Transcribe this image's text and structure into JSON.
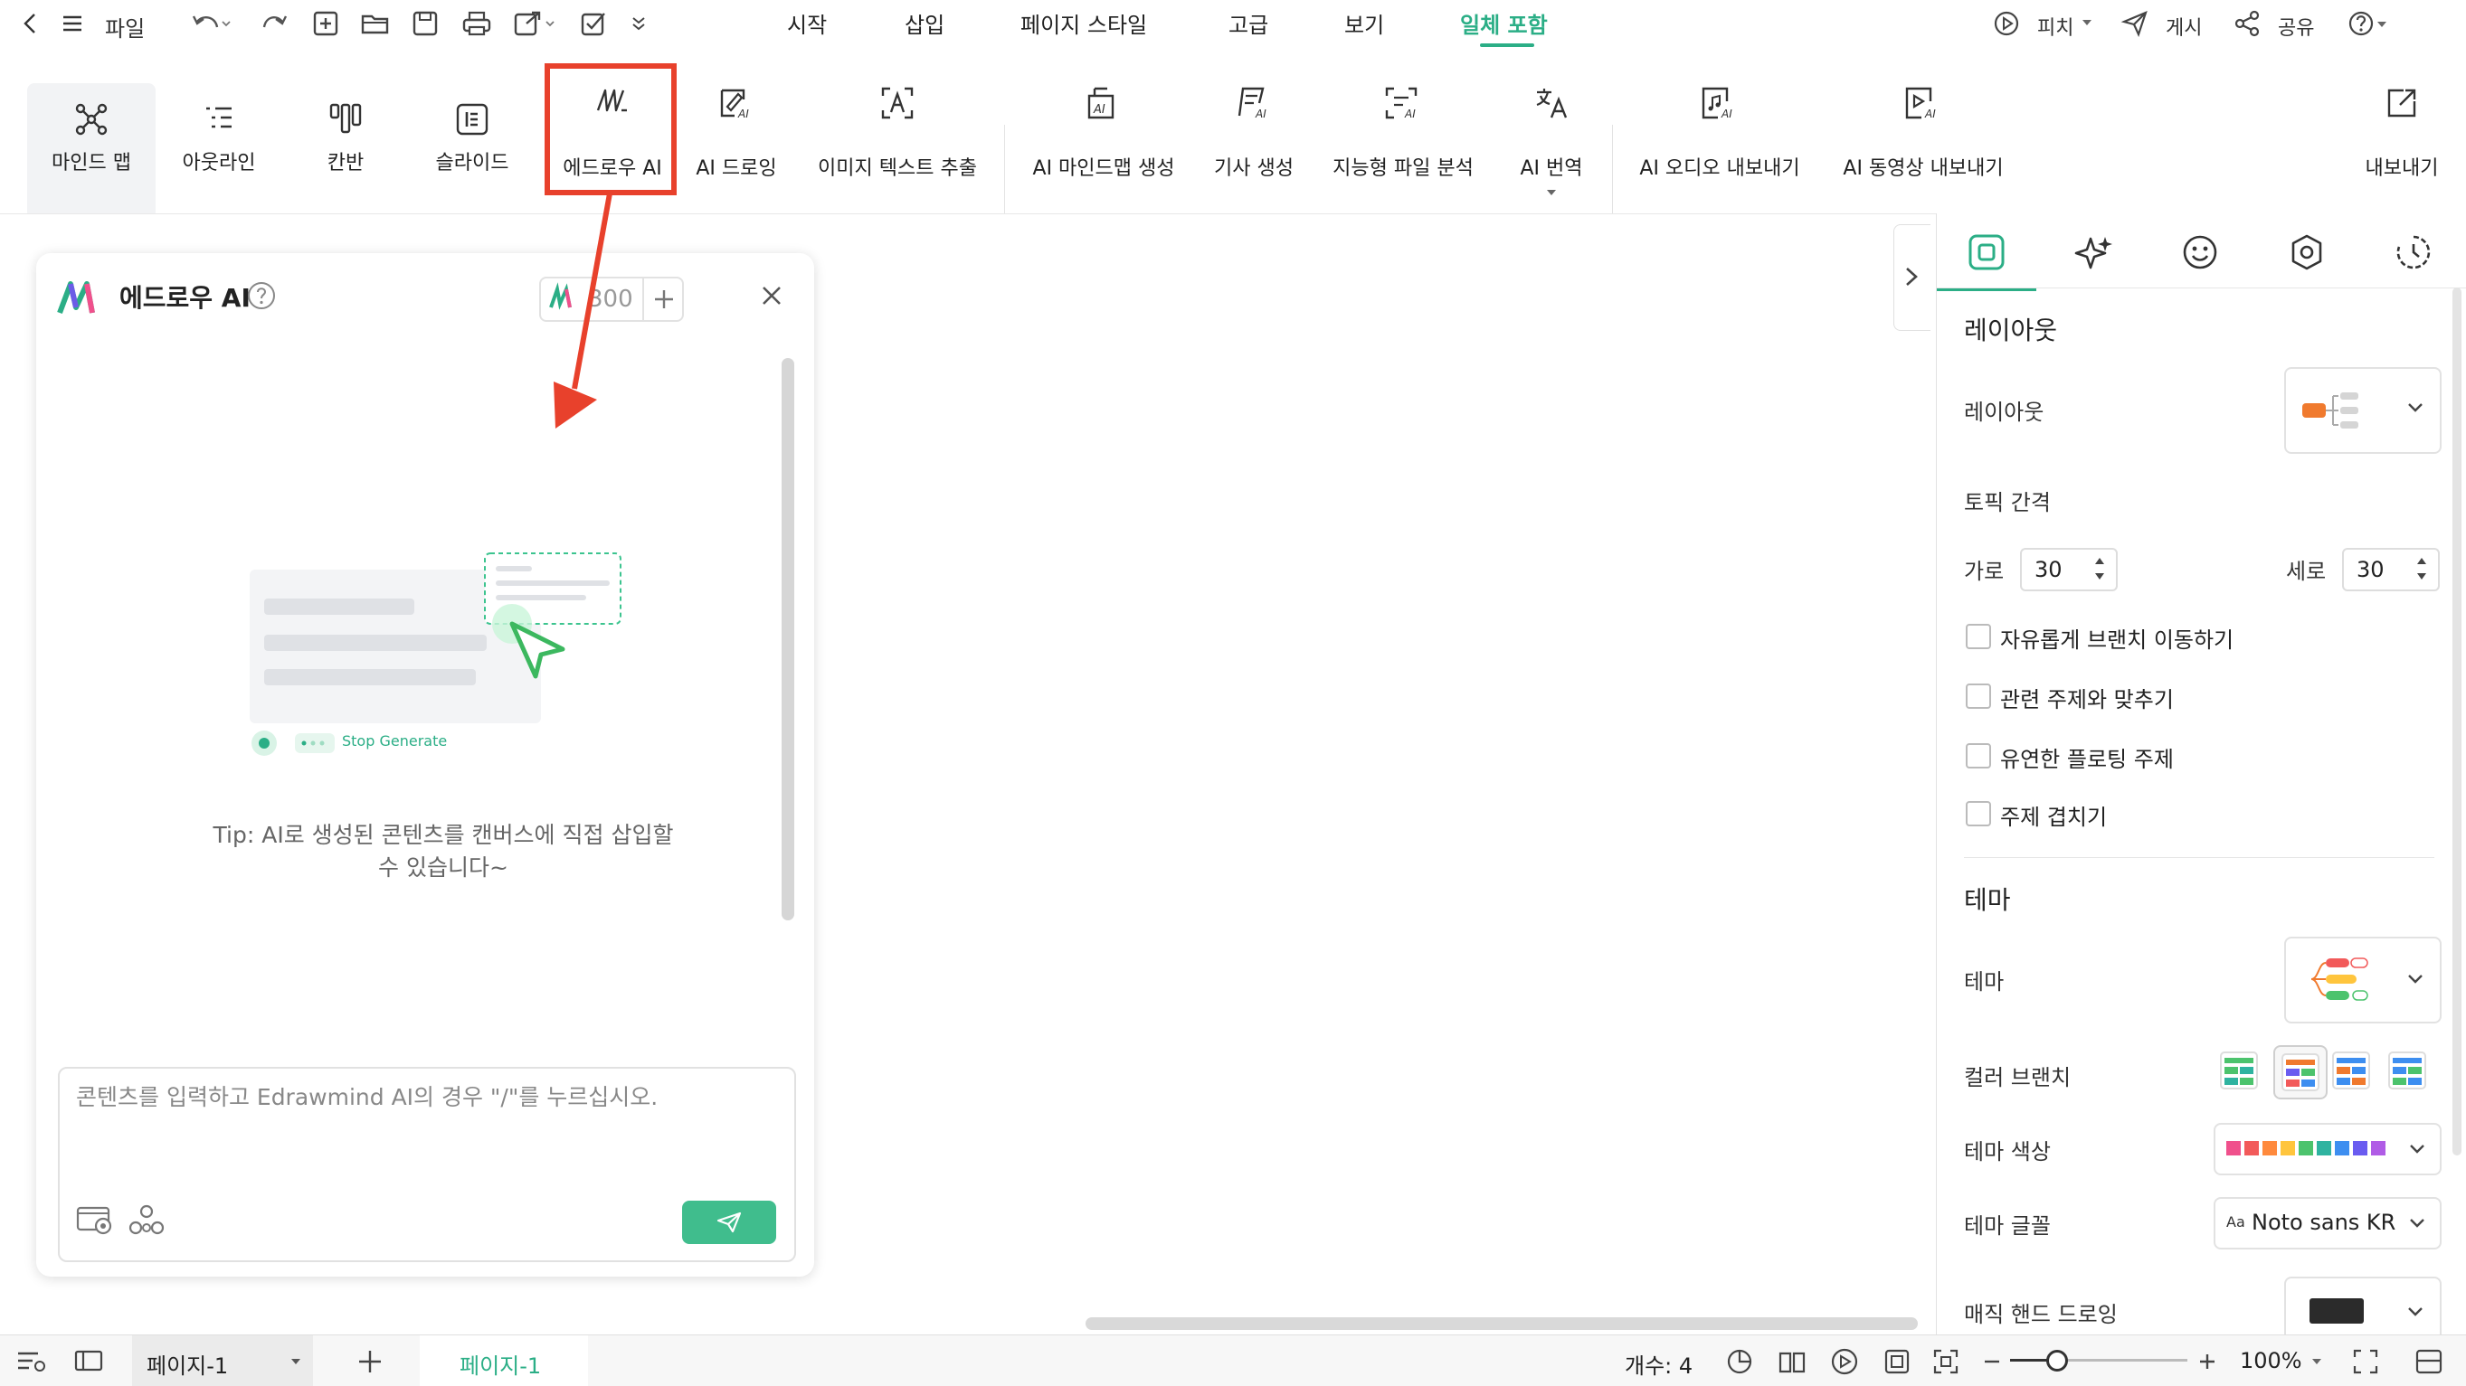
{
  "menubar": {
    "file_label": "파일",
    "tabs": [
      {
        "label": "시작"
      },
      {
        "label": "삽입"
      },
      {
        "label": "페이지 스타일"
      },
      {
        "label": "고급"
      },
      {
        "label": "보기"
      },
      {
        "label": "일체 포함",
        "active": true
      }
    ],
    "pitch_label": "피치",
    "publish_label": "게시",
    "share_label": "공유"
  },
  "ribbon": {
    "items": [
      {
        "label": "마인드 맵",
        "icon": "mindmap-icon",
        "selected": true
      },
      {
        "label": "아웃라인",
        "icon": "outline-icon"
      },
      {
        "label": "칸반",
        "icon": "kanban-icon"
      },
      {
        "label": "슬라이드",
        "icon": "slides-icon"
      },
      {
        "label": "에드로우 AI",
        "icon": "edraw-ai-icon",
        "highlighted": true
      },
      {
        "label": "AI 드로잉",
        "icon": "ai-drawing-icon"
      },
      {
        "label": "이미지 텍스트 추출",
        "icon": "image-text-extract-icon"
      },
      {
        "label": "AI 마인드맵 생성",
        "icon": "ai-mindmap-generate-icon"
      },
      {
        "label": "기사 생성",
        "icon": "article-generate-icon"
      },
      {
        "label": "지능형 파일 분석",
        "icon": "file-analysis-icon"
      },
      {
        "label": "AI 번역",
        "icon": "translate-icon"
      },
      {
        "label": "AI 오디오 내보내기",
        "icon": "ai-audio-export-icon"
      },
      {
        "label": "AI 동영상 내보내기",
        "icon": "ai-video-export-icon"
      },
      {
        "label": "내보내기",
        "icon": "export-icon"
      }
    ]
  },
  "ai_panel": {
    "title": "에드로우 AI",
    "credits": "300",
    "illustration_badge": "Stop Generate",
    "tip": "Tip: AI로 생성된 콘텐츠를 캔버스에 직접 삽입할 수 있습니다~",
    "input_placeholder": "콘텐츠를 입력하고 Edrawmind AI의 경우 \"/\"를 누르십시오."
  },
  "right_panel": {
    "tabs": [
      "layout-tab-icon",
      "ai-style-icon",
      "emoji-icon",
      "settings-icon",
      "history-icon"
    ],
    "layout_section": "레이아웃",
    "layout_label": "레이아웃",
    "spacing_label": "토픽 간격",
    "horizontal_label": "가로",
    "horizontal_value": "30",
    "vertical_label": "세로",
    "vertical_value": "30",
    "checkboxes": [
      {
        "label": "자유롭게 브랜치 이동하기",
        "checked": false
      },
      {
        "label": "관련 주제와 맞추기",
        "checked": false
      },
      {
        "label": "유연한 플로팅 주제",
        "checked": false
      },
      {
        "label": "주제 겹치기",
        "checked": false
      }
    ],
    "theme_section": "테마",
    "theme_label": "테마",
    "color_branch_label": "컬러 브랜치",
    "theme_color_label": "테마 색상",
    "theme_colors": [
      "#f0508c",
      "#f25a5a",
      "#ff8a3d",
      "#ffc53d",
      "#4cc36d",
      "#2fb3a0",
      "#3d8ef0",
      "#6a5cf0",
      "#b05ce6"
    ],
    "theme_font_label": "테마 글꼴",
    "theme_font_prefix": "Aa",
    "theme_font_value": "Noto sans KR",
    "magic_hand_label": "매직 핸드 드로잉"
  },
  "statusbar": {
    "page_selector": "페이지-1",
    "page_tab": "페이지-1",
    "count": "개수: 4",
    "zoom": "100%"
  },
  "colors": {
    "accent": "#2bae86",
    "highlight_red": "#e8412c"
  }
}
